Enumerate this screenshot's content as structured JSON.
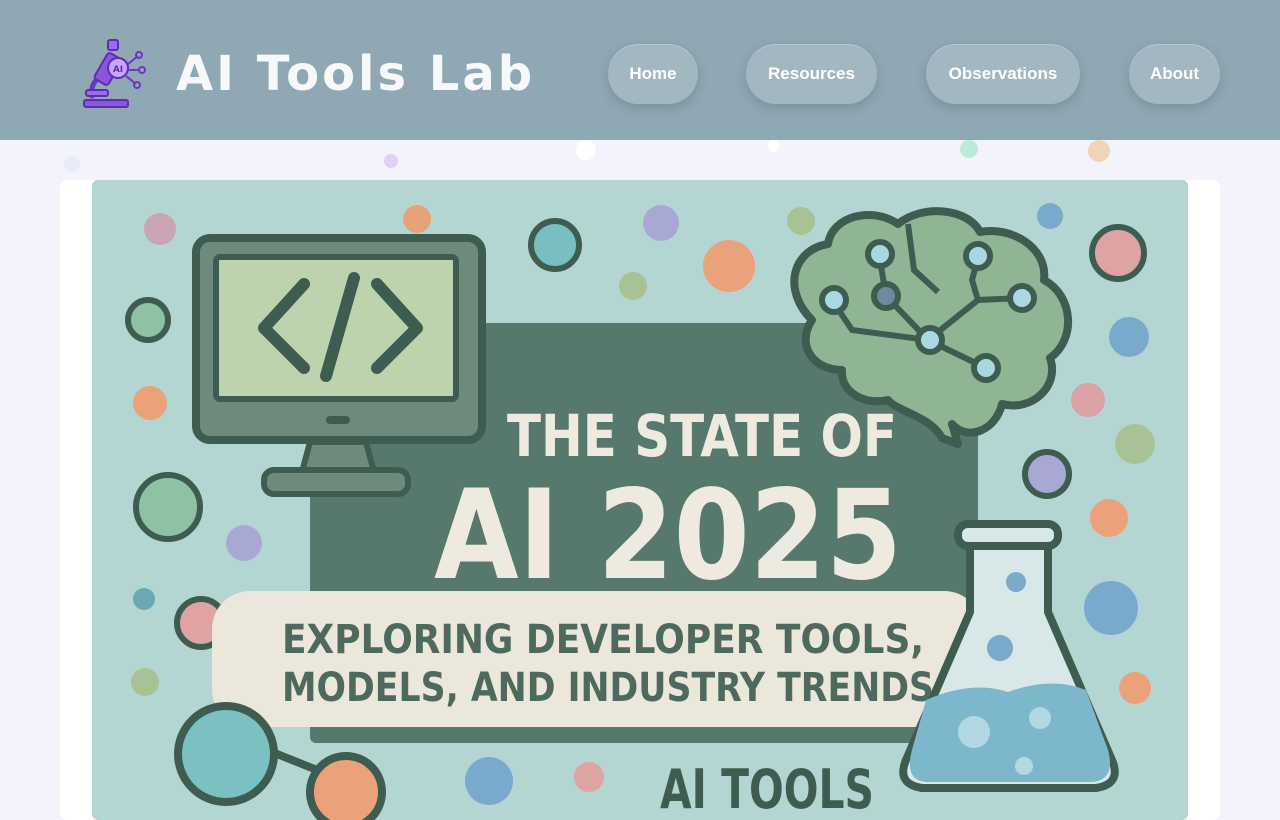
{
  "header": {
    "site_title": "AI Tools Lab",
    "logo_icon": "microscope-ai-icon",
    "logo_badge": "AI"
  },
  "nav": {
    "items": [
      {
        "label": "Home"
      },
      {
        "label": "Resources"
      },
      {
        "label": "Observations"
      },
      {
        "label": "About"
      }
    ]
  },
  "hero": {
    "title_line1": "THE STATE OF",
    "title_line2": "AI 2025",
    "subtitle_line1": "EXPLORING DEVELOPER TOOLS,",
    "subtitle_line2": "MODELS, AND INDUSTRY TRENDS",
    "footer_fragment": "AI TOOLS",
    "icons": [
      "code-monitor-icon",
      "brain-circuit-icon",
      "flask-icon",
      "network-nodes-icon"
    ]
  },
  "colors": {
    "header_bg": "#8fa8b3",
    "page_bg": "#f3f4fb",
    "banner_bg": "#b4d6d3",
    "panel": "#57796d",
    "cream": "#efeadf",
    "dark_green": "#3f5c50"
  }
}
